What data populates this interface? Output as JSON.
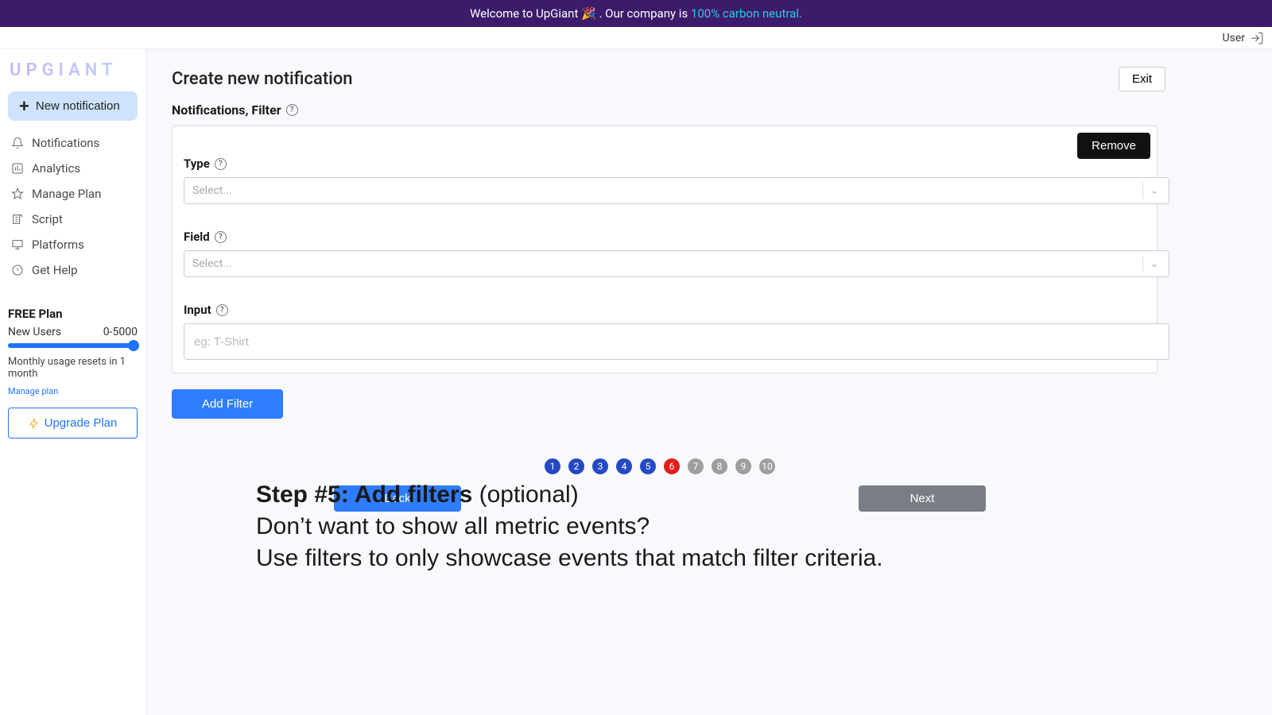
{
  "banner": {
    "prefix": "Welcome to UpGiant 🎉 . Our company is ",
    "highlight": "100% carbon neutral."
  },
  "topnav": {
    "user_label": "User"
  },
  "brand": "UPGIANT",
  "sidebar": {
    "new_notification": "New notification",
    "items": [
      {
        "label": "Notifications"
      },
      {
        "label": "Analytics"
      },
      {
        "label": "Manage Plan"
      },
      {
        "label": "Script"
      },
      {
        "label": "Platforms"
      },
      {
        "label": "Get Help"
      }
    ],
    "plan": {
      "title": "FREE Plan",
      "metric_label": "New Users",
      "metric_range": "0-5000",
      "reset_text": "Monthly usage resets in 1 month",
      "manage_link": "Manage plan",
      "upgrade_label": "Upgrade Plan"
    }
  },
  "main": {
    "title": "Create new notification",
    "exit": "Exit",
    "subtitle": "Notifications, Filter",
    "remove": "Remove",
    "type_label": "Type",
    "field_label": "Field",
    "input_label": "Input",
    "select_placeholder": "Select...",
    "input_placeholder": "eg: T-Shirt",
    "add_filter": "Add Filter",
    "steps": [
      "1",
      "2",
      "3",
      "4",
      "5",
      "6",
      "7",
      "8",
      "9",
      "10"
    ],
    "current_step": 6,
    "completed_upto": 5,
    "back": "Back",
    "next": "Next"
  },
  "annotation": {
    "bold": "Step #5: Add filters",
    "rest1": " (optional)",
    "line2": "Don’t want to show all metric events?",
    "line3": "Use filters to only showcase events that match filter criteria."
  }
}
